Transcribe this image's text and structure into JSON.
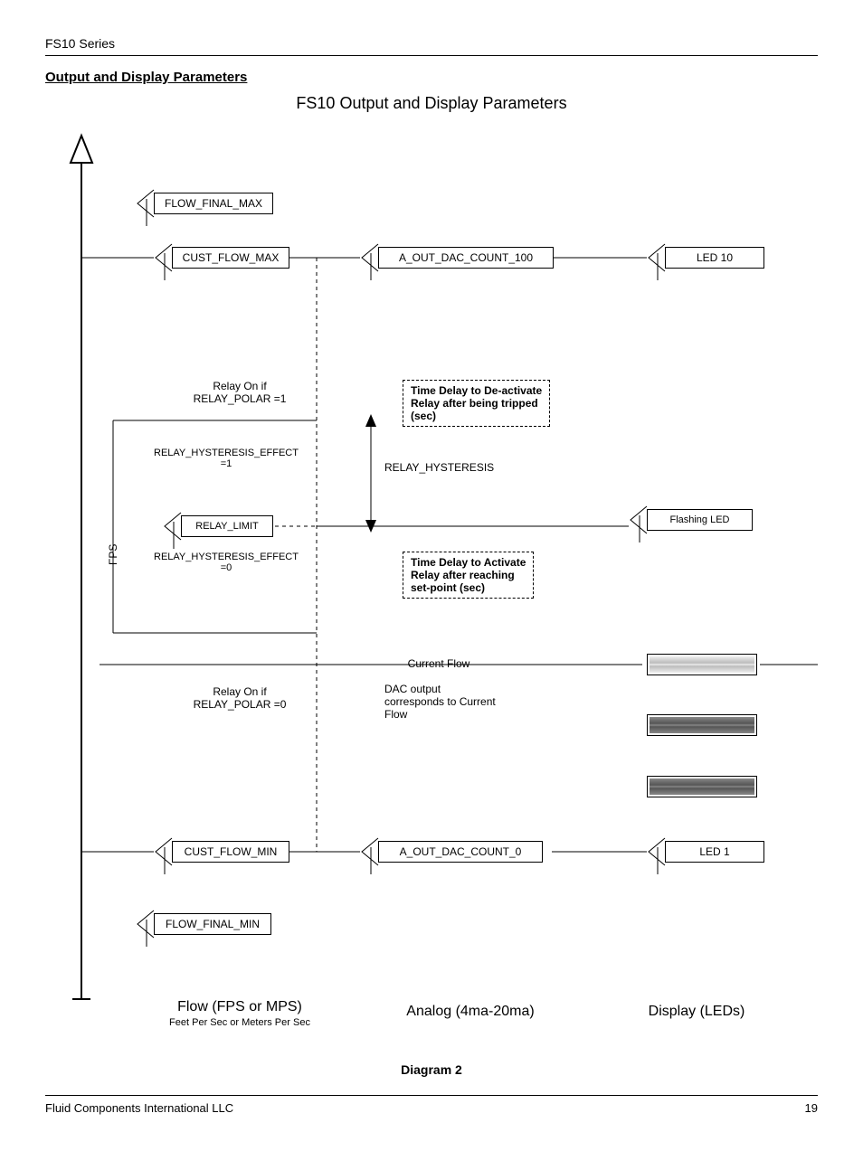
{
  "header": {
    "series": "FS10 Series"
  },
  "section": {
    "title": "Output and Display Parameters"
  },
  "diagram": {
    "title": "FS10 Output and Display Parameters",
    "caption": "Diagram 2",
    "yaxis_label": "FPS",
    "col_flow": {
      "title": "Flow (FPS or MPS)",
      "subtitle": "Feet Per Sec or Meters Per Sec",
      "flow_final_max": "FLOW_FINAL_MAX",
      "cust_flow_max": "CUST_FLOW_MAX",
      "relay_on_polar1": "Relay On if\nRELAY_POLAR =1",
      "relay_hyst_effect1": "RELAY_HYSTERESIS_EFFECT\n=1",
      "relay_limit": "RELAY_LIMIT",
      "relay_hyst_effect0": "RELAY_HYSTERESIS_EFFECT\n=0",
      "relay_on_polar0": "Relay On if\nRELAY_POLAR =0",
      "cust_flow_min": "CUST_FLOW_MIN",
      "flow_final_min": "FLOW_FINAL_MIN"
    },
    "col_analog": {
      "title": "Analog (4ma-20ma)",
      "a_out_dac_100": "A_OUT_DAC_COUNT_100",
      "a_out_dac_0": "A_OUT_DAC_COUNT_0",
      "time_delay_deact": "Time Delay to De-activate\nRelay  after being tripped\n(sec)",
      "relay_hysteresis": "RELAY_HYSTERESIS",
      "time_delay_act": "Time Delay to Activate\nRelay  after reaching\nset-point (sec)",
      "current_flow": "Current Flow",
      "dac_output": "DAC output\ncorresponds to Current\nFlow"
    },
    "col_display": {
      "title": "Display (LEDs)",
      "led10": "LED 10",
      "flashing_led": "Flashing LED",
      "led1": "LED 1"
    }
  },
  "footer": {
    "company": "Fluid Components International LLC",
    "page": "19"
  }
}
